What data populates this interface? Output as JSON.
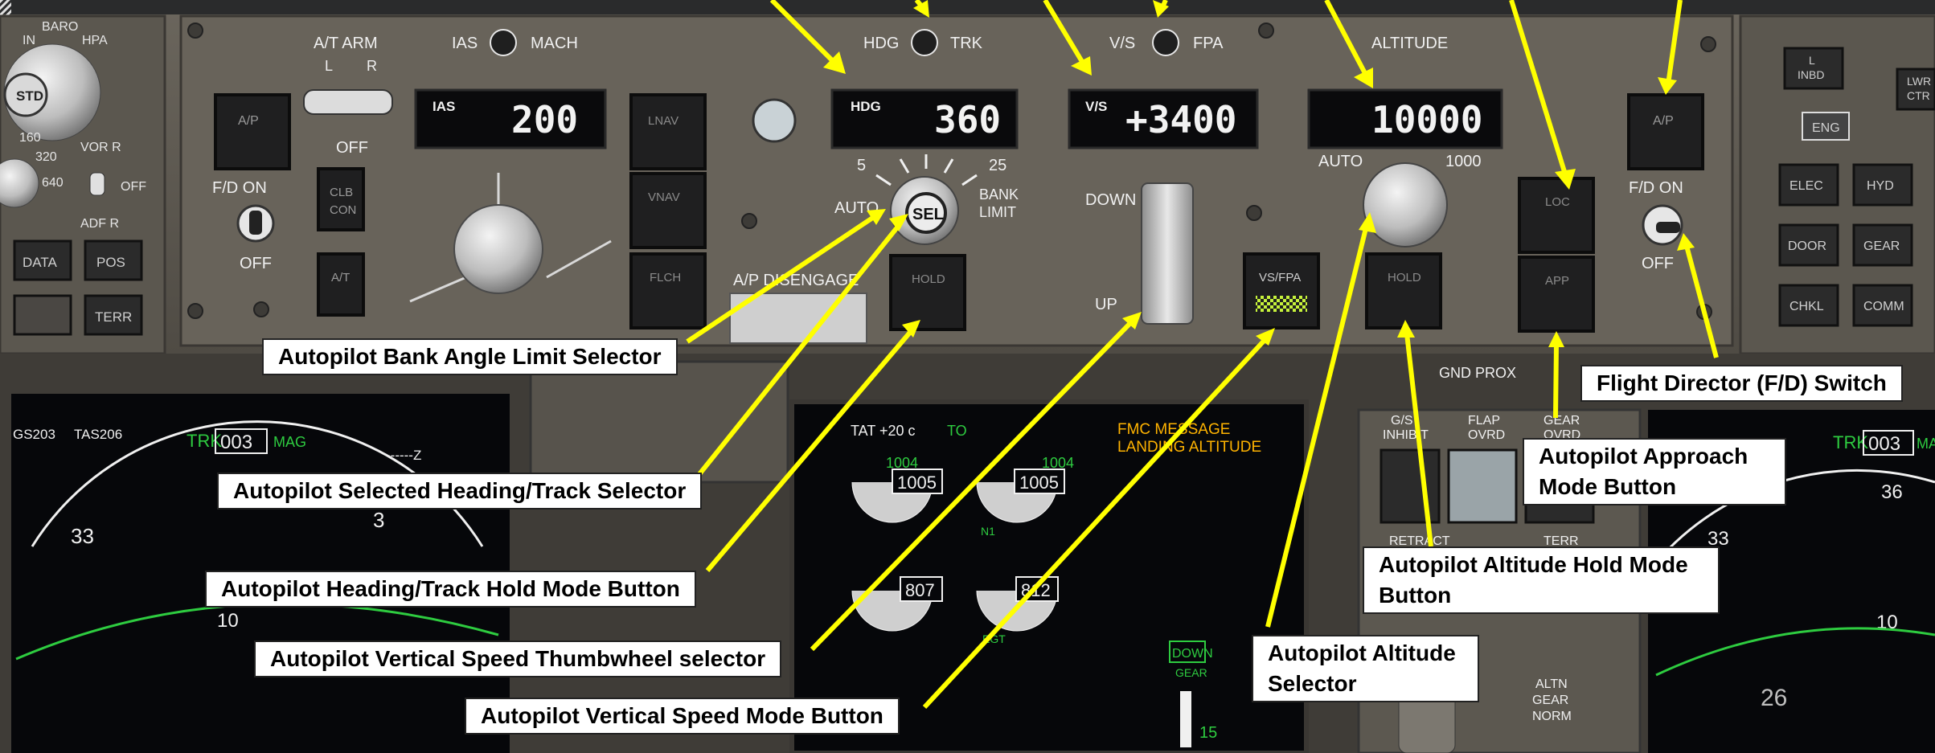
{
  "panel": {
    "left_panel": {
      "baro": "BARO",
      "in": "IN",
      "hpa": "HPA",
      "std": "STD",
      "vor_r": "VOR R",
      "off": "OFF",
      "adf_r": "ADF R",
      "data": "DATA",
      "pos": "POS",
      "terr": "TERR",
      "scale": [
        "160",
        "320",
        "640"
      ]
    },
    "mcp": {
      "at_arm": "A/T ARM",
      "at_l": "L",
      "at_r": "R",
      "at_off": "OFF",
      "ias_mach": [
        "IAS",
        "MACH"
      ],
      "ias_tag": "IAS",
      "ias_value": "200",
      "ap_button": "A/P",
      "fd_on": "F/D ON",
      "fd_off": "OFF",
      "clb_con": [
        "CLB",
        "CON"
      ],
      "at_button": "A/T",
      "lnav": "LNAV",
      "vnav": "VNAV",
      "flch": "FLCH",
      "hdg_trk": [
        "HDG",
        "TRK"
      ],
      "hdg_tag": "HDG",
      "hdg_value": "360",
      "bank_5": "5",
      "bank_25": "25",
      "auto": "AUTO",
      "sel": "SEL",
      "bank_limit": [
        "BANK",
        "LIMIT"
      ],
      "hdg_hold": "HOLD",
      "ap_disengage": "A/P DISENGAGE",
      "vs_fpa": [
        "V/S",
        "FPA"
      ],
      "vs_tag": "V/S",
      "vs_value": "+3400",
      "down": "DOWN",
      "up": "UP",
      "vsfpa_button": "VS/FPA",
      "altitude": "ALTITUDE",
      "alt_value": "10000",
      "alt_auto": "AUTO",
      "alt_1000": "1000",
      "alt_hold": "HOLD",
      "loc": "LOC",
      "app": "APP",
      "right_ap": "A/P",
      "right_fd_on": "F/D ON",
      "right_fd_off": "OFF"
    },
    "eicas_right": {
      "inbd": [
        "L",
        "INBD"
      ],
      "lwr_ctr": [
        "LWR",
        "CTR"
      ],
      "eng": "ENG",
      "elec": "ELEC",
      "hyd": "HYD",
      "door": "DOOR",
      "gear": "GEAR",
      "chkl": "CHKL",
      "comm": "COMM"
    },
    "lower": {
      "gs": "GS203",
      "tas": "TAS206",
      "trk": "TRK",
      "trk_value": "003",
      "mag": "MAG",
      "nd_dashes": "------Z",
      "nd_33": "33",
      "nd_3": "3",
      "nd_10": "10",
      "tat": "TAT +20 c",
      "to": "TO",
      "fmc_msg": "FMC MESSAGE",
      "landing_alt": "LANDING ALTITUDE",
      "n1_left_top": "1004",
      "n1_left_box": "1005",
      "n1_right_top": "1004",
      "n1_right_box": "1005",
      "n1": "N1",
      "egt_left": "807",
      "egt_right": "812",
      "egt": "EGT",
      "down": "DOWN",
      "gear": "GEAR",
      "flaps_15": "15",
      "gnd_prox": "GND PROX",
      "gs_inhibit": [
        "G/S",
        "INHIBIT"
      ],
      "flap_ovrd": [
        "FLAP",
        "OVRD"
      ],
      "gear_ovrd": [
        "GEAR",
        "OVRD"
      ],
      "retract": "RETRACT",
      "terr": "TERR",
      "altn_gear": [
        "ALTN",
        "GEAR",
        "NORM"
      ],
      "right_trk": "TRK",
      "right_trk_value": "003",
      "right_ma": "MA",
      "right_36": "36",
      "right_33": "33",
      "right_10": "10"
    }
  },
  "labels": {
    "bank_angle": "Autopilot Bank Angle Limit Selector",
    "heading_selector": "Autopilot Selected Heading/Track Selector",
    "heading_hold": "Autopilot Heading/Track Hold Mode Button",
    "vs_thumbwheel": "Autopilot Vertical Speed Thumbwheel selector",
    "vs_mode": "Autopilot Vertical Speed Mode Button",
    "altitude_selector": "Autopilot Altitude Selector",
    "altitude_hold": "Autopilot Altitude Hold Mode Button",
    "approach_mode": "Autopilot Approach Mode Button",
    "fd_switch": "Flight Director (F/D) Switch"
  },
  "page_number": "26",
  "colors": {
    "arrow": "#ffff00",
    "panel": "#5f5a52",
    "display_bg": "#0a0a0c",
    "digits": "#f2f2f2",
    "green": "#2ecc40",
    "cyan": "#5fd0ff",
    "amber": "#ffb300",
    "magenta": "#e040e0"
  }
}
